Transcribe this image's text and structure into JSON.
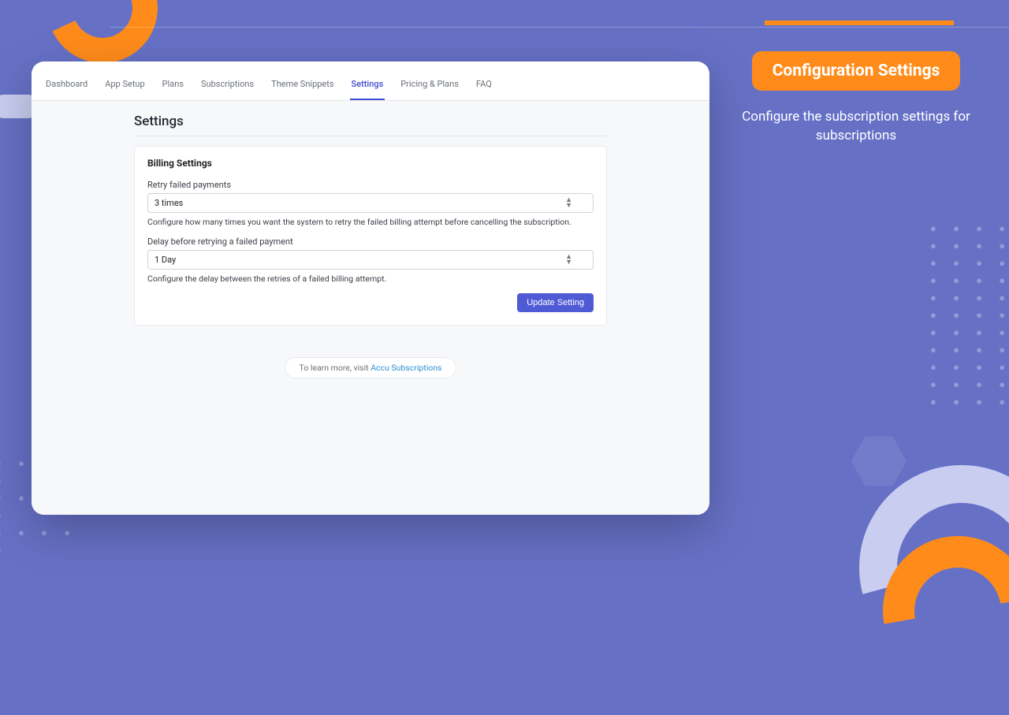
{
  "nav": {
    "items": [
      {
        "label": "Dashboard"
      },
      {
        "label": "App Setup"
      },
      {
        "label": "Plans"
      },
      {
        "label": "Subscriptions"
      },
      {
        "label": "Theme Snippets"
      },
      {
        "label": "Settings"
      },
      {
        "label": "Pricing & Plans"
      },
      {
        "label": "FAQ"
      }
    ],
    "active_index": 5
  },
  "page": {
    "title": "Settings"
  },
  "billing": {
    "section_title": "Billing Settings",
    "retry": {
      "label": "Retry failed payments",
      "value": "3 times",
      "help": "Configure how many times you want the system to retry the failed billing attempt before cancelling the subscription."
    },
    "delay": {
      "label": "Delay before retrying a failed payment",
      "value": "1 Day",
      "help": "Configure the delay between the retries of a failed billing attempt."
    },
    "update_button": "Update Setting"
  },
  "learn_more": {
    "prefix": "To learn more, visit ",
    "link_text": "Accu Subscriptions"
  },
  "sidebar": {
    "heading": "Configuration Settings",
    "description": "Configure the subscription settings for subscriptions"
  }
}
